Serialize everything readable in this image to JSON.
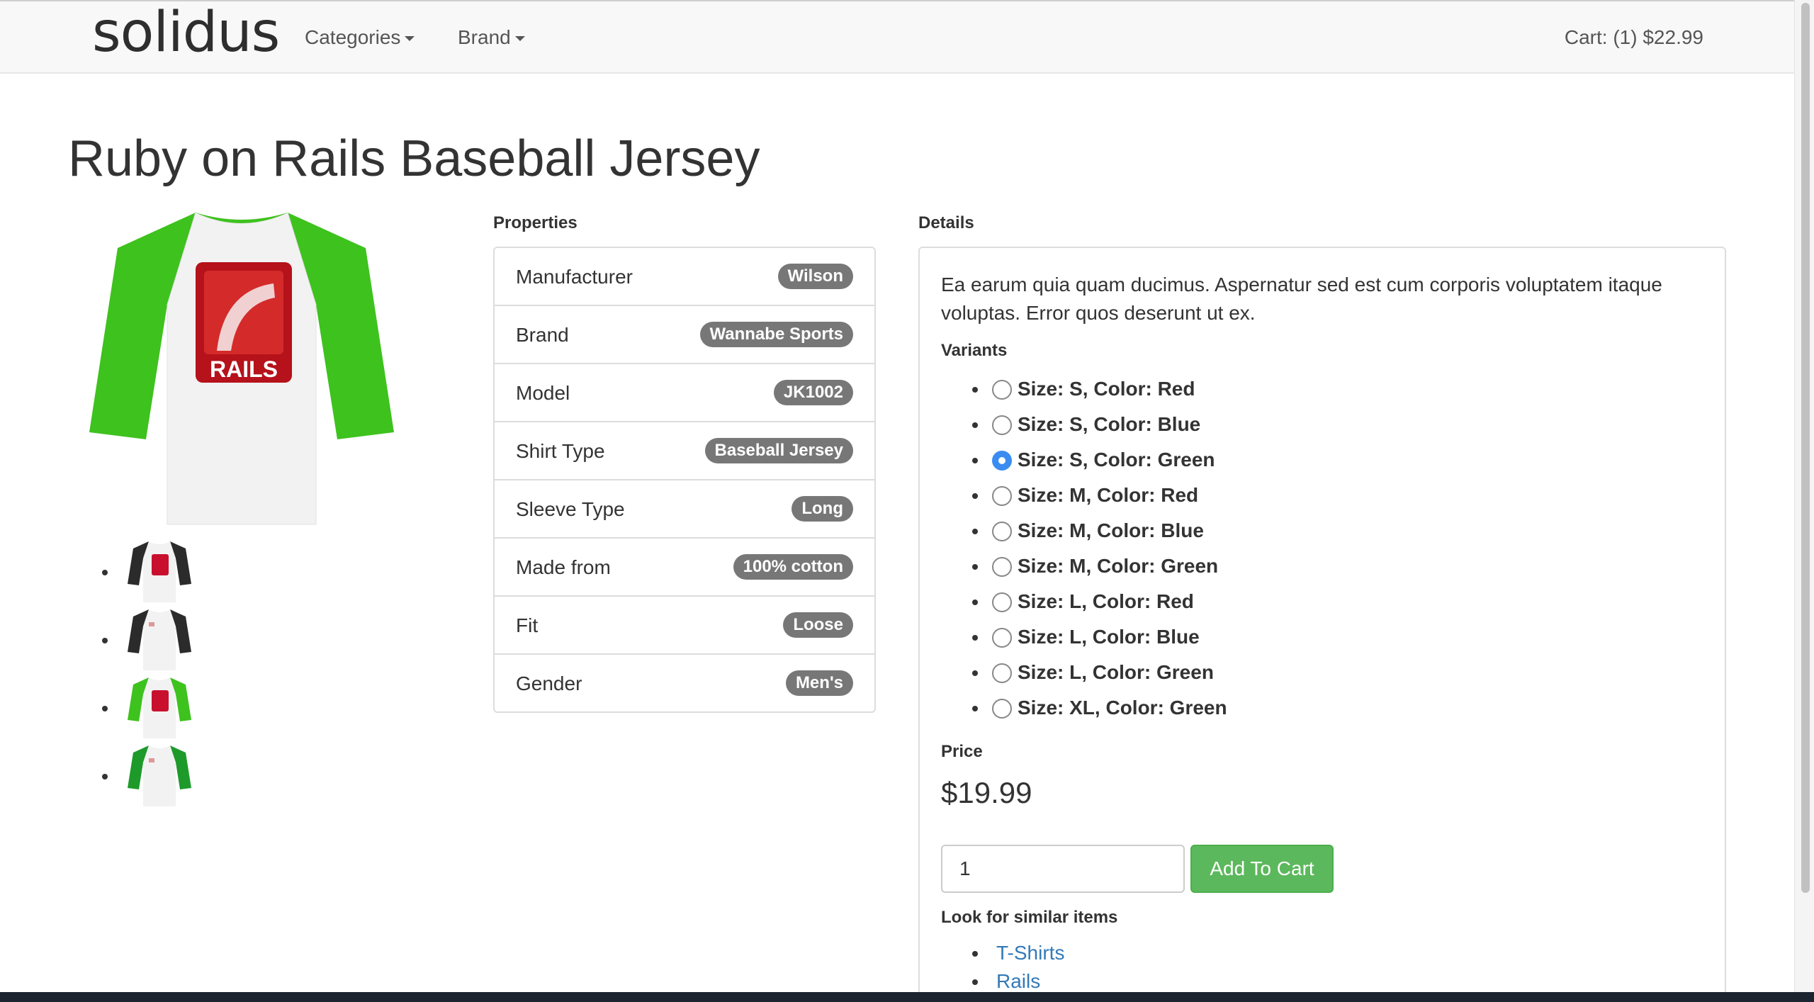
{
  "navbar": {
    "brand": "solidus",
    "categories_label": "Categories",
    "brand_menu_label": "Brand",
    "cart_label": "Cart: (1) $22.99"
  },
  "product": {
    "title": "Ruby on Rails Baseball Jersey",
    "main_image_text": "RAILS",
    "thumbnail_colors": [
      "#2b2b2b",
      "#2b2b2b",
      "#3ec21e",
      "#1e9a2a"
    ]
  },
  "properties": {
    "label": "Properties",
    "items": [
      {
        "name": "Manufacturer",
        "value": "Wilson"
      },
      {
        "name": "Brand",
        "value": "Wannabe Sports"
      },
      {
        "name": "Model",
        "value": "JK1002"
      },
      {
        "name": "Shirt Type",
        "value": "Baseball Jersey"
      },
      {
        "name": "Sleeve Type",
        "value": "Long"
      },
      {
        "name": "Made from",
        "value": "100% cotton"
      },
      {
        "name": "Fit",
        "value": "Loose"
      },
      {
        "name": "Gender",
        "value": "Men's"
      }
    ]
  },
  "details": {
    "label": "Details",
    "description": "Ea earum quia quam ducimus. Aspernatur sed est cum corporis voluptatem itaque voluptas. Error quos deserunt ut ex.",
    "variants_label": "Variants",
    "variants": [
      {
        "label": "Size: S, Color: Red",
        "checked": false
      },
      {
        "label": "Size: S, Color: Blue",
        "checked": false
      },
      {
        "label": "Size: S, Color: Green",
        "checked": true
      },
      {
        "label": "Size: M, Color: Red",
        "checked": false
      },
      {
        "label": "Size: M, Color: Blue",
        "checked": false
      },
      {
        "label": "Size: M, Color: Green",
        "checked": false
      },
      {
        "label": "Size: L, Color: Red",
        "checked": false
      },
      {
        "label": "Size: L, Color: Blue",
        "checked": false
      },
      {
        "label": "Size: L, Color: Green",
        "checked": false
      },
      {
        "label": "Size: XL, Color: Green",
        "checked": false
      }
    ],
    "price_label": "Price",
    "price": "$19.99",
    "quantity": "1",
    "add_to_cart_label": "Add To Cart",
    "similar_label": "Look for similar items",
    "similar_items": [
      "T-Shirts",
      "Rails"
    ]
  },
  "colors": {
    "sleeve_green": "#3ec21e",
    "rails_red": "#c8102e",
    "button_green": "#5cb85c",
    "radio_blue": "#3b8cf0",
    "link_blue": "#337ab7"
  }
}
